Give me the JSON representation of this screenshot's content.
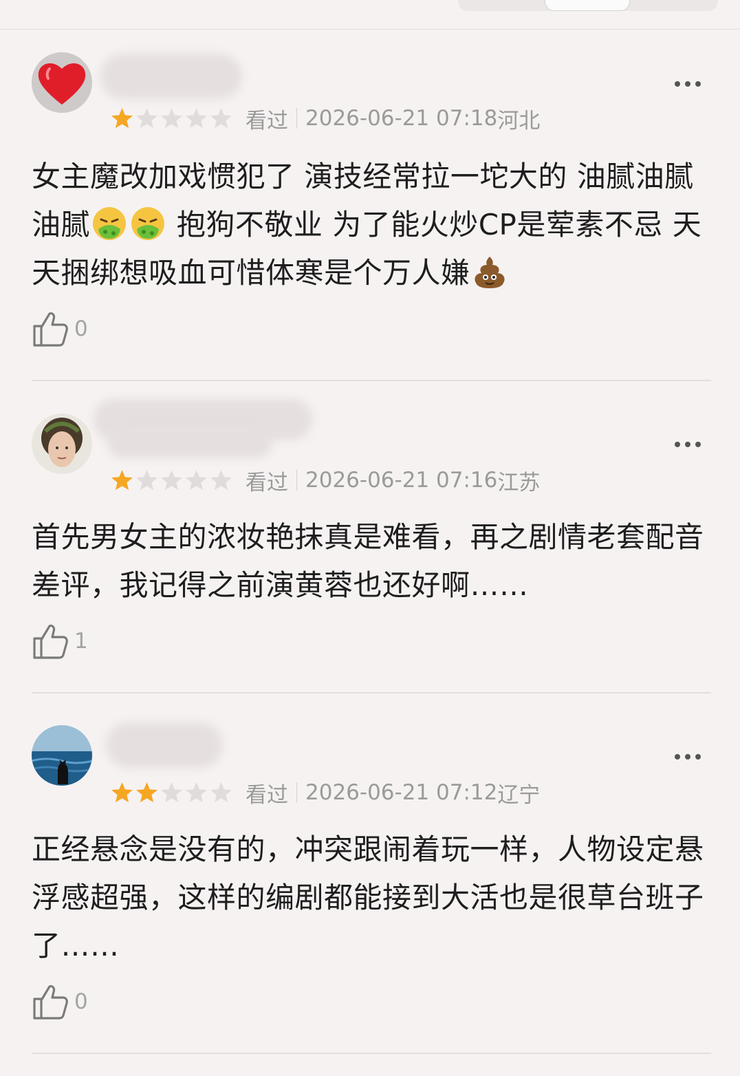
{
  "reviews": [
    {
      "stars": 1,
      "status": "看过",
      "datetime": "2026-06-21 07:18",
      "location": "河北",
      "text_parts": [
        "女主魔改加戏惯犯了 演技经常拉一坨大的 油腻油腻油腻",
        " 抱狗不敬业 为了能火炒CP是荤素不忌 天天捆绑想吸血可惜体寒是个万人嫌"
      ],
      "emojis": [
        "nauseated-face-emoji",
        "nauseated-face-emoji",
        "pile-of-poo-emoji"
      ],
      "likes": "0"
    },
    {
      "stars": 1,
      "status": "看过",
      "datetime": "2026-06-21 07:16",
      "location": "江苏",
      "text": "首先男女主的浓妆艳抹真是难看，再之剧情老套配音差评，我记得之前演黄蓉也还好啊……",
      "likes": "1"
    },
    {
      "stars": 2,
      "status": "看过",
      "datetime": "2026-06-21 07:12",
      "location": "辽宁",
      "text": "正经悬念是没有的，冲突跟闹着玩一样，人物设定悬浮感超强，这样的编剧都能接到大活也是很草台班子了……",
      "likes": "0"
    }
  ],
  "colors": {
    "star_on": "#f5a623",
    "star_off": "#e0dcdc",
    "meta_text": "#9a9a9a",
    "background": "#f6f2f2"
  },
  "icons": {
    "like": "thumbs-up-icon",
    "more": "more-dots-icon",
    "star": "star-icon"
  }
}
